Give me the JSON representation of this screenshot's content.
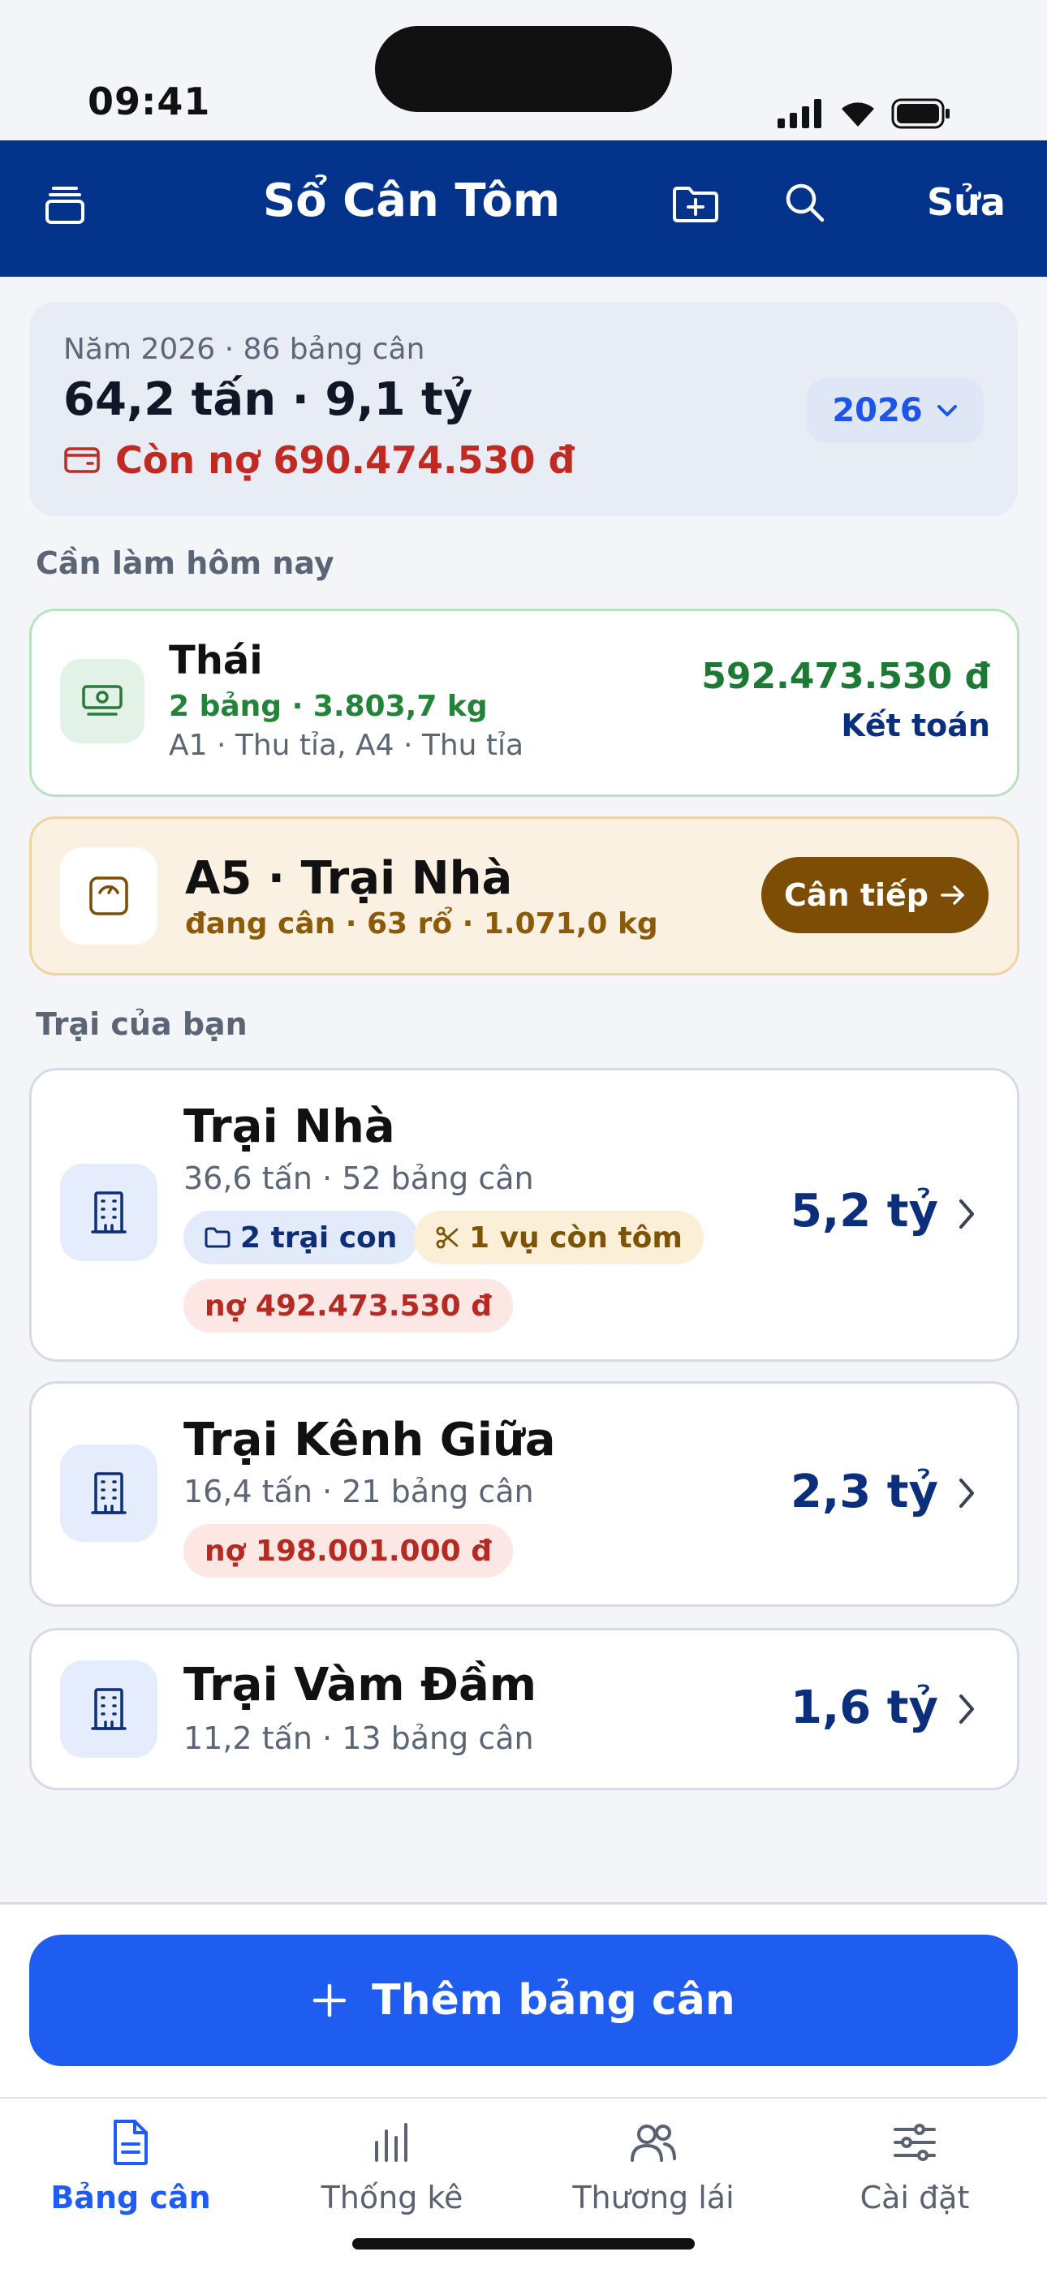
{
  "status": {
    "time": "09:41"
  },
  "nav": {
    "title": "Sổ Cân Tôm",
    "edit": "Sửa",
    "icons": [
      "stack-icon",
      "folder-plus-icon",
      "search-icon"
    ]
  },
  "summary": {
    "subtitle": "Năm 2026 · 86 bảng cân",
    "main": "64,2 tấn · 9,1 tỷ",
    "debt": "Còn nợ 690.474.530 đ",
    "year": "2026"
  },
  "today": {
    "label": "Cần làm hôm nay",
    "settle": {
      "name": "Thái",
      "line1": "2 bảng · 3.803,7 kg",
      "line2": "A1 · Thu tỉa, A4 · Thu tỉa",
      "amount": "592.473.530 đ",
      "action": "Kết toán"
    },
    "weighing": {
      "title": "A5 · Trại Nhà",
      "subtitle": "đang cân · 63 rổ · 1.071,0 kg",
      "action": "Cân tiếp"
    }
  },
  "farms": {
    "label": "Trại của bạn",
    "items": [
      {
        "name": "Trại Nhà",
        "sub": "36,6 tấn · 52 bảng cân",
        "value": "5,2 tỷ",
        "chip_sub": "2 trại con",
        "chip_crop": "1 vụ còn tôm",
        "chip_debt": "nợ 492.473.530 đ"
      },
      {
        "name": "Trại Kênh Giữa",
        "sub": "16,4 tấn · 21 bảng cân",
        "value": "2,3 tỷ",
        "chip_debt": "nợ 198.001.000 đ"
      },
      {
        "name": "Trại Vàm Đầm",
        "sub": "11,2 tấn · 13 bảng cân",
        "value": "1,6 tỷ"
      }
    ]
  },
  "add_button": "Thêm bảng cân",
  "tabs": [
    {
      "label": "Bảng cân",
      "icon": "document-icon",
      "active": true
    },
    {
      "label": "Thống kê",
      "icon": "bar-chart-icon"
    },
    {
      "label": "Thương lái",
      "icon": "users-icon"
    },
    {
      "label": "Cài đặt",
      "icon": "sliders-icon"
    }
  ],
  "colors": {
    "navy": "#03338a",
    "accent": "#1f5cf0",
    "green": "#1c7a35",
    "red": "#c12a22",
    "brown": "#7d4d05"
  }
}
